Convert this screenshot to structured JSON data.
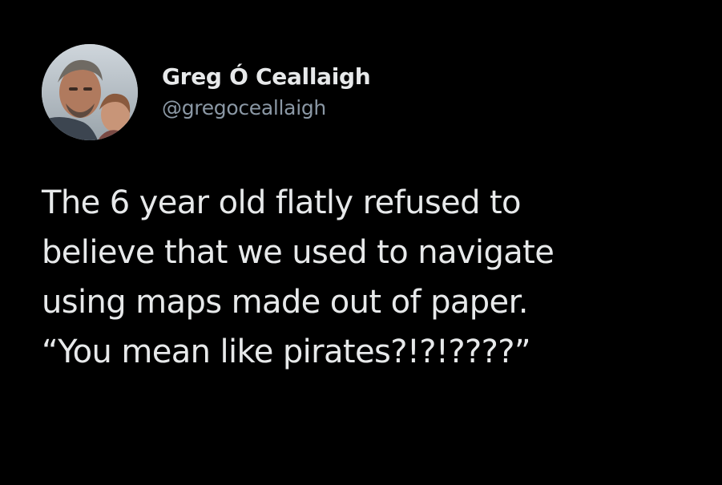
{
  "author": {
    "display_name": "Greg Ó Ceallaigh",
    "handle": "@gregoceallaigh",
    "avatar_icon": "profile-photo-avatar"
  },
  "tweet": {
    "lines": [
      "The 6 year old flatly refused to",
      "believe that we used to navigate",
      "using maps made out of paper.",
      "“You mean like pirates?!?!????”"
    ]
  },
  "colors": {
    "background": "#000000",
    "text_primary": "#e7e9ea",
    "text_secondary": "#8b98a5"
  }
}
